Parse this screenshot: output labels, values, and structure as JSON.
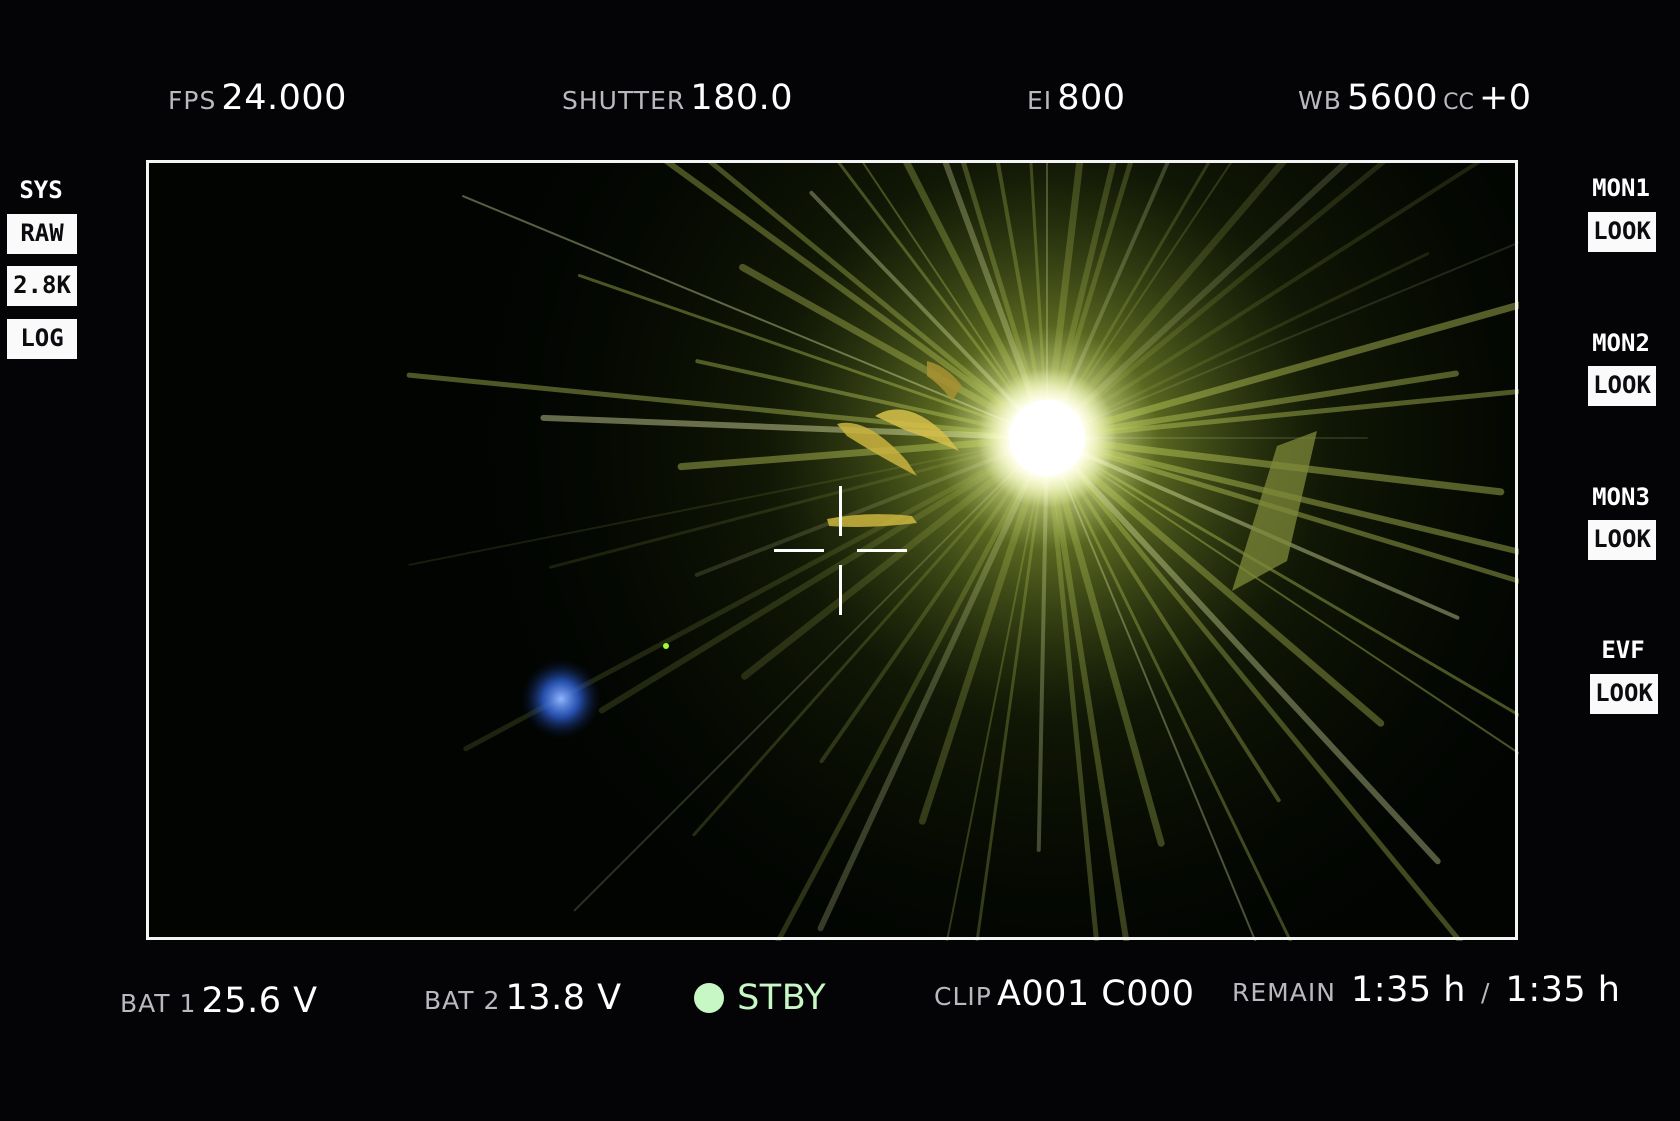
{
  "top": {
    "fps": {
      "label": "FPS",
      "value": "24.000"
    },
    "shutter": {
      "label": "SHUTTER",
      "value": "180.0"
    },
    "ei": {
      "label": "EI",
      "value": "800"
    },
    "wb": {
      "label": "WB",
      "value": "5600",
      "cc_label": "CC",
      "cc_value": "+0"
    }
  },
  "left_panel": {
    "title": "SYS",
    "tags": [
      "RAW",
      "2.8K",
      "LOG"
    ]
  },
  "right_panel": {
    "monitors": [
      {
        "title": "MON1",
        "tag": "LOOK"
      },
      {
        "title": "MON2",
        "tag": "LOOK"
      },
      {
        "title": "MON3",
        "tag": "LOOK"
      },
      {
        "title": "EVF",
        "tag": "LOOK"
      }
    ]
  },
  "bottom": {
    "bat1": {
      "label": "BAT 1",
      "value": "25.6 V"
    },
    "bat2": {
      "label": "BAT 2",
      "value": "13.8 V"
    },
    "status": {
      "value": "STBY",
      "color": "#c6f7c4"
    },
    "clip": {
      "label": "CLIP",
      "value": "A001 C000"
    },
    "remain": {
      "label": "REMAIN",
      "value1": "1:35 h",
      "separator": "/",
      "value2": "1:35 h"
    }
  },
  "colors": {
    "background": "#040407",
    "frame": "#f4f4f4",
    "tag_bg": "#fafafa",
    "label": "#b9b9bf",
    "flare": "#f6ffb0"
  }
}
